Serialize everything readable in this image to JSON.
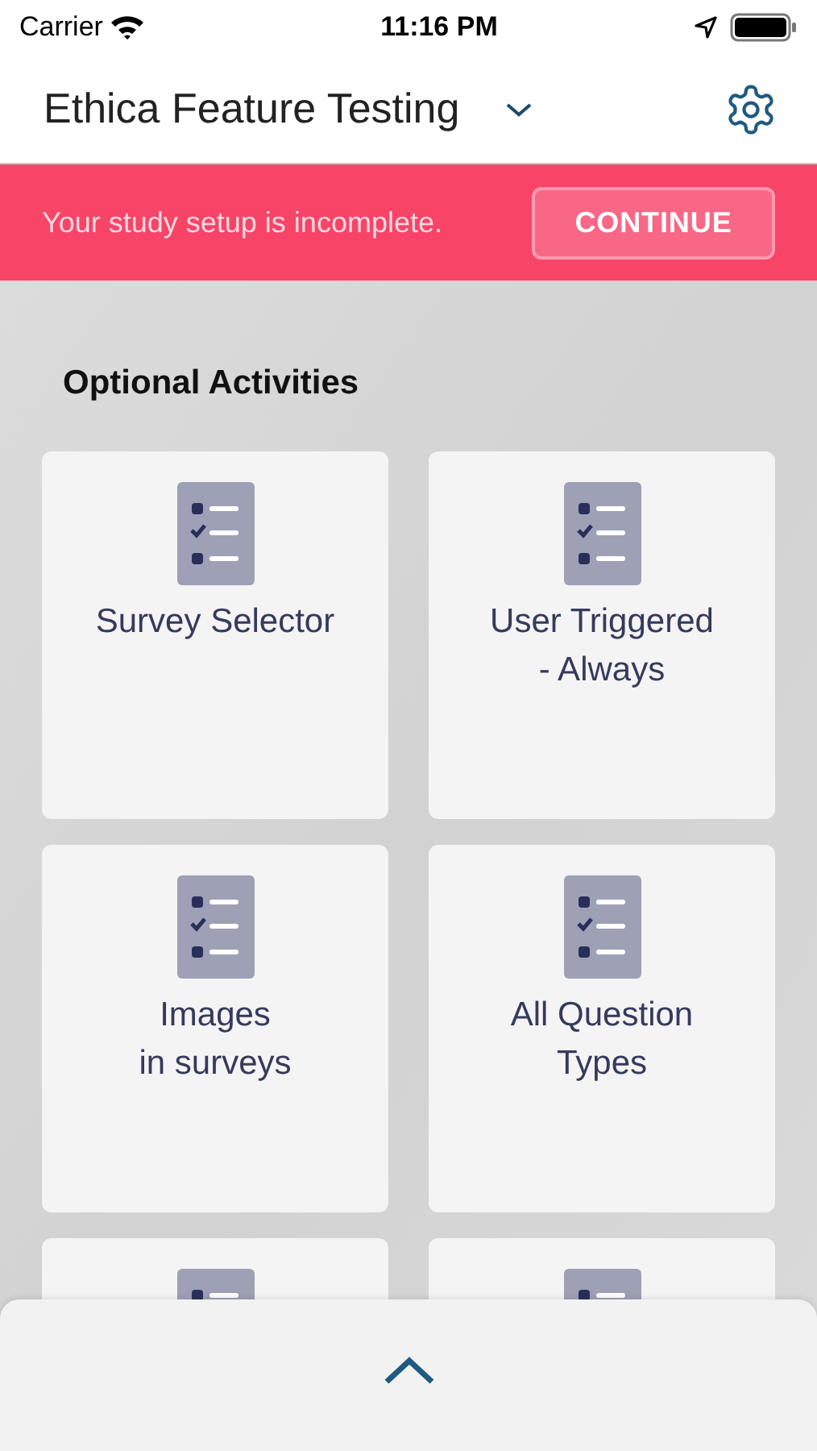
{
  "status_bar": {
    "carrier": "Carrier",
    "time": "11:16 PM"
  },
  "header": {
    "title": "Ethica Feature Testing"
  },
  "banner": {
    "message": "Your study setup is incomplete.",
    "button": "CONTINUE"
  },
  "section": {
    "title": "Optional Activities"
  },
  "activities": [
    {
      "kind": "titled",
      "lines": [
        "Survey Selector"
      ]
    },
    {
      "kind": "titled",
      "lines": [
        "User Triggered",
        "- Always"
      ]
    },
    {
      "kind": "titled",
      "lines": [
        "Images",
        "in surveys"
      ]
    },
    {
      "kind": "titled",
      "lines": [
        "All Question",
        "Types"
      ]
    },
    {
      "kind": "cut_off"
    },
    {
      "kind": "cut_off"
    }
  ]
}
